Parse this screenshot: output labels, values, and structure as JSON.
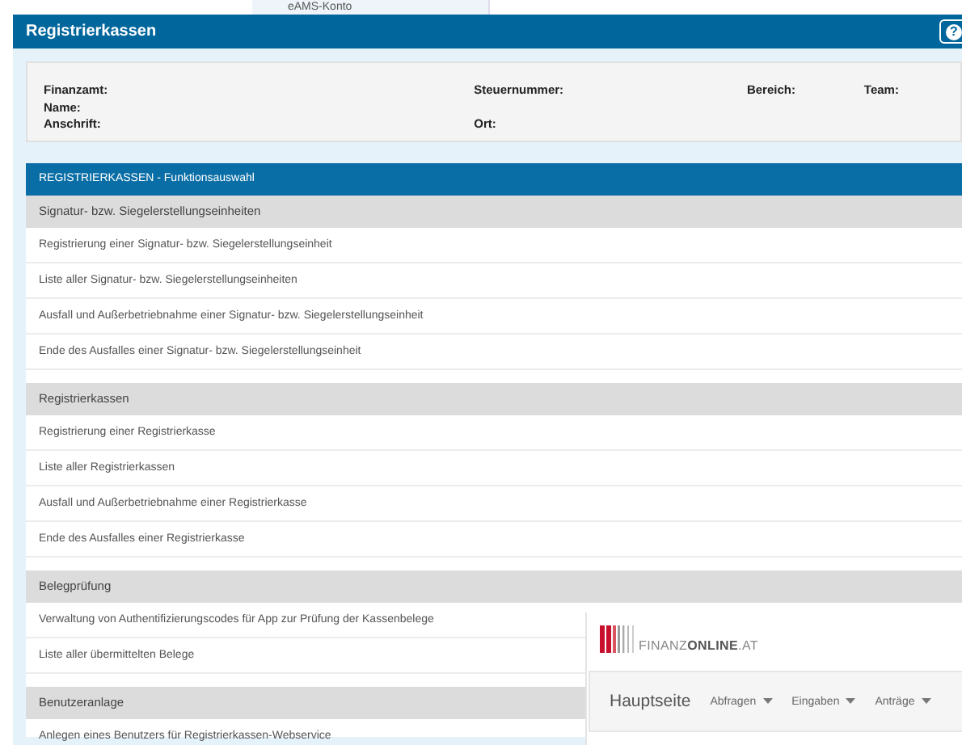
{
  "top_strip": {
    "link": "eAMS-Konto"
  },
  "window": {
    "title": "Registrierkassen",
    "help_label": "?"
  },
  "info": {
    "columns": [
      [
        "Finanzamt:",
        "Name:",
        "Anschrift:"
      ],
      [
        "Steuernummer:",
        null,
        "Ort:"
      ],
      [
        "Bereich:"
      ],
      [
        "Team:"
      ]
    ]
  },
  "menu": {
    "title": "REGISTRIERKASSEN - Funktionsauswahl",
    "groups": [
      {
        "header": "Signatur- bzw. Siegelerstellungseinheiten",
        "items": [
          "Registrierung einer Signatur- bzw. Siegelerstellungseinheit",
          "Liste aller Signatur- bzw. Siegelerstellungseinheiten",
          "Ausfall und Außerbetriebnahme einer Signatur- bzw. Siegelerstellungseinheit",
          "Ende des Ausfalles einer Signatur- bzw. Siegelerstellungseinheit"
        ]
      },
      {
        "header": "Registrierkassen",
        "items": [
          "Registrierung einer Registrierkasse",
          "Liste aller Registrierkassen",
          "Ausfall und Außerbetriebnahme einer Registrierkasse",
          "Ende des Ausfalles einer Registrierkasse"
        ]
      },
      {
        "header": "Belegprüfung",
        "items": [
          "Verwaltung von Authentifizierungscodes für App zur Prüfung der Kassenbelege",
          "Liste aller übermittelten Belege"
        ]
      },
      {
        "header": "Benutzeranlage",
        "items": [
          "Anlegen eines Benutzers für Registrierkassen-Webservice"
        ]
      }
    ]
  },
  "overlay": {
    "logo_text": "FINANZ**ONLINE**.AT",
    "nav": [
      {
        "label": "Hauptseite",
        "dropdown": false
      },
      {
        "label": "Abfragen",
        "dropdown": true
      },
      {
        "label": "Eingaben",
        "dropdown": true
      },
      {
        "label": "Anträge",
        "dropdown": true
      }
    ]
  }
}
